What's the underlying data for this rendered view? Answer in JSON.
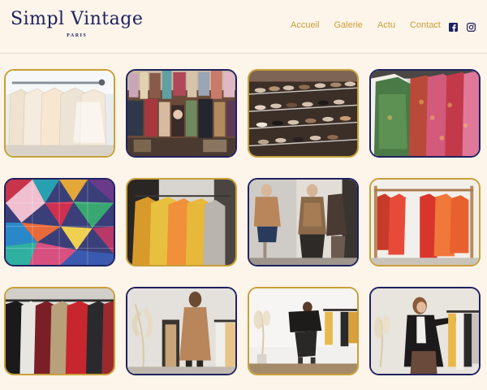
{
  "header": {
    "logo_title": "Simpl Vintage",
    "logo_subtitle": "PARIS"
  },
  "nav": {
    "items": [
      {
        "label": "Accueil"
      },
      {
        "label": "Galerie"
      },
      {
        "label": "Actu"
      },
      {
        "label": "Contact"
      }
    ]
  },
  "social": {
    "icons": [
      "facebook-icon",
      "instagram-icon"
    ]
  },
  "colors": {
    "background": "#fdf4ea",
    "navy": "#1f2260",
    "gold": "#c8a038"
  },
  "gallery": {
    "tiles": [
      {
        "subject": "rack of cream and white blouses on hangers",
        "border": "gold"
      },
      {
        "subject": "crowded vintage shop with hanging clothes",
        "border": "navy"
      },
      {
        "subject": "shelves of vintage shoes",
        "border": "gold"
      },
      {
        "subject": "colorful patterned jackets on rack",
        "border": "navy"
      },
      {
        "subject": "patchwork colorful fabric",
        "border": "navy"
      },
      {
        "subject": "orange and yellow sweaters on hangers",
        "border": "gold"
      },
      {
        "subject": "mannequins in vintage outfits",
        "border": "navy"
      },
      {
        "subject": "red and orange garments on wooden rack",
        "border": "gold"
      },
      {
        "subject": "black and red coats on rack",
        "border": "gold"
      },
      {
        "subject": "woman browsing clothes rack",
        "border": "navy"
      },
      {
        "subject": "woman trying on clothes in studio",
        "border": "gold"
      },
      {
        "subject": "woman in blazer holding hanger",
        "border": "navy"
      }
    ]
  }
}
